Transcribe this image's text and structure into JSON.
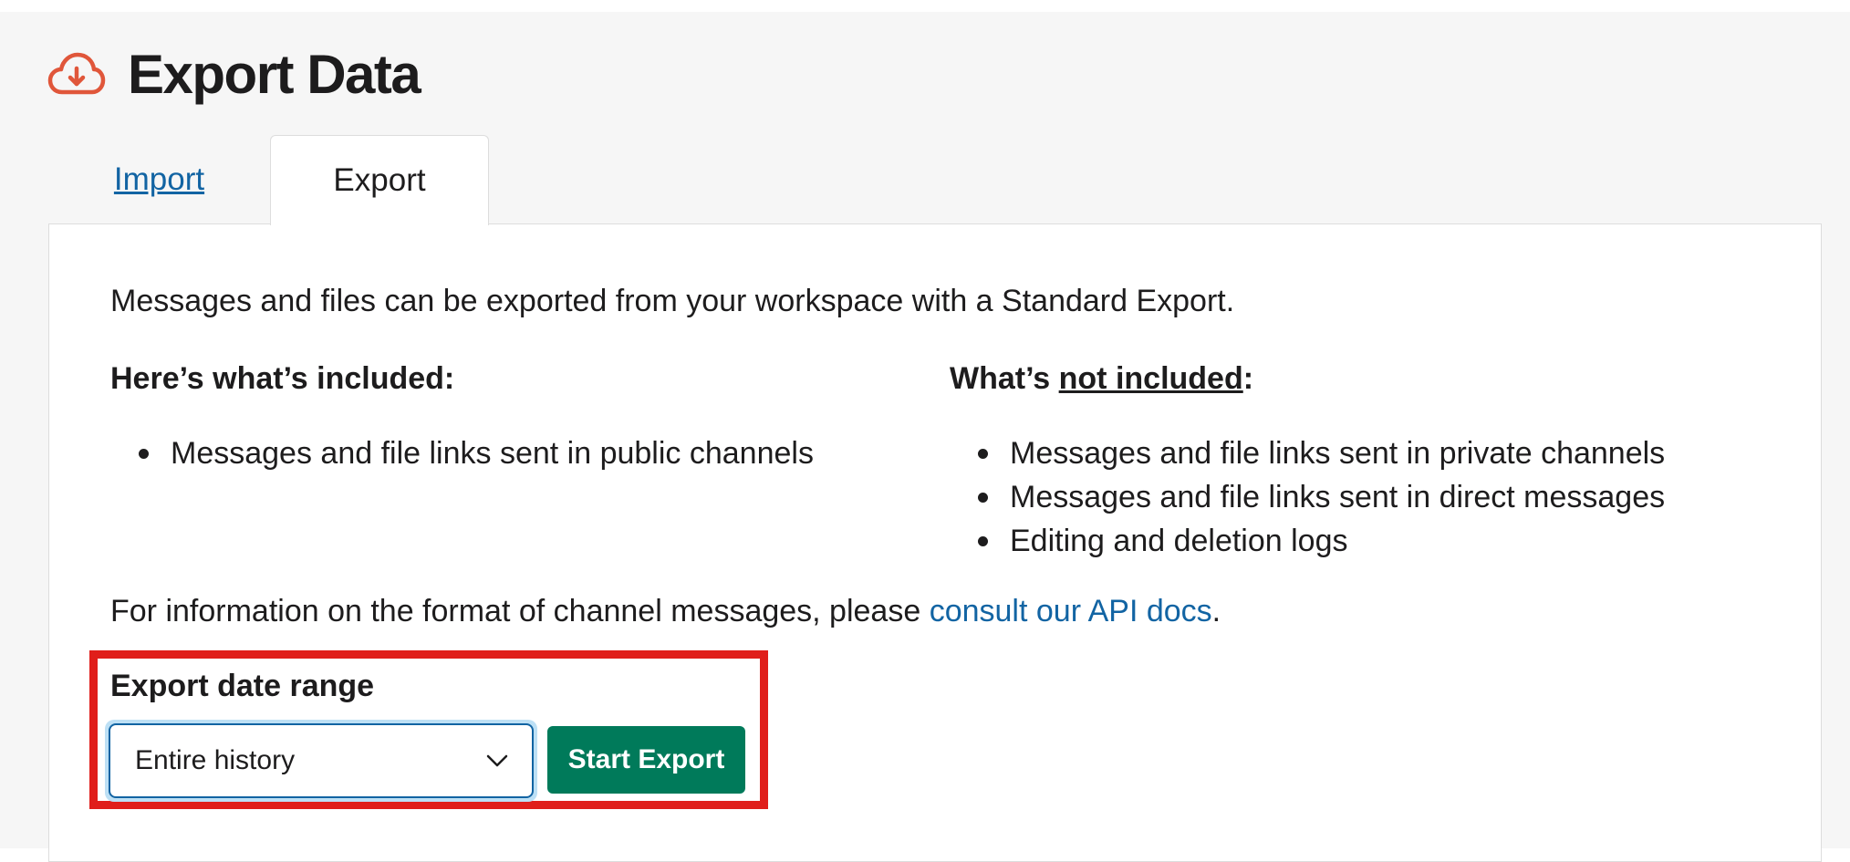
{
  "header": {
    "icon": "cloud-download-icon",
    "title": "Export Data"
  },
  "tabs": [
    {
      "label": "Import",
      "active": false
    },
    {
      "label": "Export",
      "active": true
    }
  ],
  "intro": "Messages and files can be exported from your workspace with a Standard Export.",
  "included": {
    "heading": "Here’s what’s included:",
    "items": [
      "Messages and file links sent in public channels"
    ]
  },
  "not_included": {
    "heading_prefix": "What’s ",
    "heading_underlined": "not included",
    "heading_suffix": ":",
    "items": [
      "Messages and file links sent in private channels",
      "Messages and file links sent in direct messages",
      "Editing and deletion logs"
    ]
  },
  "info": {
    "text": "For information on the format of channel messages, please ",
    "link": "consult our API docs",
    "end": "."
  },
  "export_form": {
    "label": "Export date range",
    "selected": "Entire history",
    "button": "Start Export"
  },
  "colors": {
    "accent_link": "#1264a3",
    "button_green": "#007a5a",
    "highlight_red": "#e01e1a",
    "icon_orange": "#e0563a"
  }
}
